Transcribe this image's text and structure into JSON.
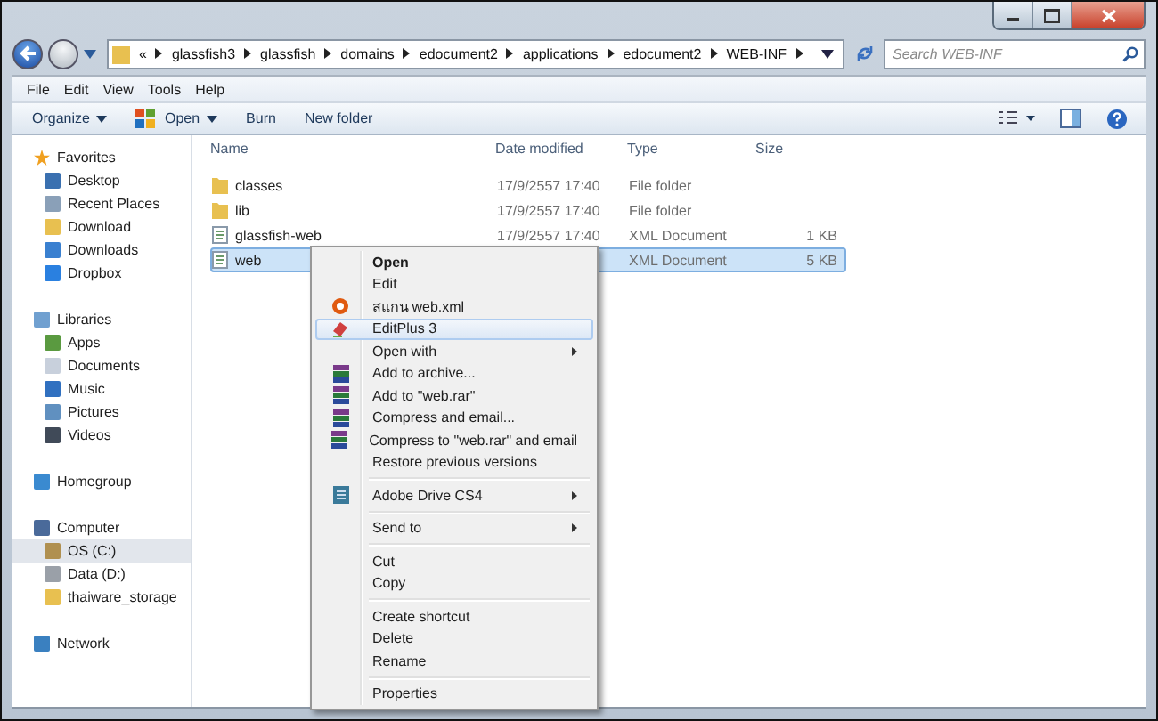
{
  "address_bar": {
    "crumbs": [
      "«",
      "glassfish3",
      "glassfish",
      "domains",
      "edocument2",
      "applications",
      "edocument2",
      "WEB-INF"
    ]
  },
  "search": {
    "placeholder": "Search WEB-INF"
  },
  "menu_bar": [
    "File",
    "Edit",
    "View",
    "Tools",
    "Help"
  ],
  "toolbar": [
    {
      "label": "Organize",
      "kind": "dropdown"
    },
    {
      "label": "Open",
      "kind": "open"
    },
    {
      "label": "Burn",
      "kind": "plain"
    },
    {
      "label": "New folder",
      "kind": "plain"
    }
  ],
  "sidebar": [
    {
      "label": "Favorites",
      "kind": "star",
      "children": [
        {
          "label": "Desktop",
          "kind": "desktop",
          "selected": false
        },
        {
          "label": "Recent Places",
          "kind": "recent",
          "selected": false
        },
        {
          "label": "Download",
          "kind": "folder",
          "selected": false
        },
        {
          "label": "Downloads",
          "kind": "downloads",
          "selected": false
        },
        {
          "label": "Dropbox",
          "kind": "dropbox",
          "selected": false
        }
      ]
    },
    {
      "label": "Libraries",
      "kind": "library",
      "children": [
        {
          "label": "Apps",
          "kind": "apps",
          "selected": false
        },
        {
          "label": "Documents",
          "kind": "document",
          "selected": false
        },
        {
          "label": "Music",
          "kind": "music",
          "selected": false
        },
        {
          "label": "Pictures",
          "kind": "pictures",
          "selected": false
        },
        {
          "label": "Videos",
          "kind": "videos",
          "selected": false
        }
      ]
    },
    {
      "label": "Homegroup",
      "kind": "homegroup"
    },
    {
      "label": "Computer",
      "kind": "computer",
      "children": [
        {
          "label": "OS (C:)",
          "kind": "osdrive",
          "selected": true
        },
        {
          "label": "Data (D:)",
          "kind": "drive",
          "selected": false
        },
        {
          "label": "thaiware_storage",
          "kind": "folder",
          "selected": false
        }
      ]
    },
    {
      "label": "Network",
      "kind": "network"
    }
  ],
  "table": {
    "columns": [
      "Name",
      "Date modified",
      "Type",
      "Size"
    ],
    "rows": [
      {
        "name": "classes",
        "kind": "folder",
        "date": "17/9/2557 17:40",
        "type": "File folder",
        "selected": false
      },
      {
        "name": "lib",
        "kind": "folder",
        "date": "17/9/2557 17:40",
        "type": "File folder",
        "selected": false
      },
      {
        "name": "glassfish-web",
        "kind": "xml",
        "date": "17/9/2557 17:40",
        "type": "XML Document",
        "size": "1 KB",
        "selected": false
      },
      {
        "name": "web",
        "kind": "xml",
        "type": "XML Document",
        "size": "5 KB",
        "selected": true
      }
    ]
  },
  "context_menu": [
    {
      "kind": "text",
      "label": "Open",
      "bold": true,
      "submenu": false,
      "selected": false
    },
    {
      "kind": "text",
      "label": "Edit",
      "bold": false,
      "submenu": false,
      "selected": false
    },
    {
      "kind": "scan",
      "label": "สแกน web.xml",
      "bold": false,
      "submenu": false,
      "selected": false
    },
    {
      "kind": "editor",
      "label": "EditPlus 3",
      "bold": false,
      "submenu": false,
      "selected": true
    },
    {
      "kind": "text",
      "label": "Open with",
      "bold": false,
      "submenu": true,
      "selected": false
    },
    {
      "kind": "archive",
      "label": "Add to archive...",
      "bold": false,
      "submenu": false,
      "selected": false
    },
    {
      "kind": "archive",
      "label": "Add to \"web.rar\"",
      "bold": false,
      "submenu": false,
      "selected": false
    },
    {
      "kind": "archive",
      "label": "Compress and email...",
      "bold": false,
      "submenu": false,
      "selected": false
    },
    {
      "kind": "archive",
      "label": "Compress to \"web.rar\" and email",
      "bold": false,
      "submenu": false,
      "selected": false
    },
    {
      "kind": "text",
      "label": "Restore previous versions",
      "bold": false,
      "submenu": false,
      "selected": false
    },
    {
      "kind": "separator"
    },
    {
      "kind": "drive",
      "label": "Adobe Drive CS4",
      "bold": false,
      "submenu": true,
      "selected": false
    },
    {
      "kind": "separator"
    },
    {
      "kind": "text",
      "label": "Send to",
      "bold": false,
      "submenu": true,
      "selected": false
    },
    {
      "kind": "separator"
    },
    {
      "kind": "text",
      "label": "Cut",
      "bold": false,
      "submenu": false,
      "selected": false
    },
    {
      "kind": "text",
      "label": "Copy",
      "bold": false,
      "submenu": false,
      "selected": false
    },
    {
      "kind": "separator"
    },
    {
      "kind": "text",
      "label": "Create shortcut",
      "bold": false,
      "submenu": false,
      "selected": false
    },
    {
      "kind": "text",
      "label": "Delete",
      "bold": false,
      "submenu": false,
      "selected": false
    },
    {
      "kind": "text",
      "label": "Rename",
      "bold": false,
      "submenu": false,
      "selected": false
    },
    {
      "kind": "separator"
    },
    {
      "kind": "text",
      "label": "Properties",
      "bold": false,
      "submenu": false,
      "selected": false
    }
  ]
}
